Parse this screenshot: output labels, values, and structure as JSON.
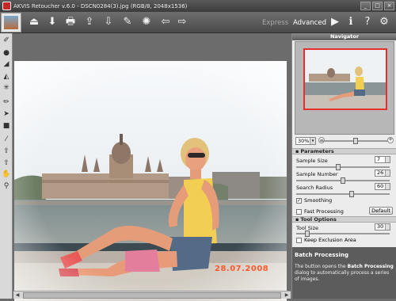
{
  "window": {
    "title": "AKVIS Retoucher v.6.0 - DSCN0284(3).jpg (RGB/8, 2048x1536)",
    "minimize": "_",
    "maximize": "□",
    "close": "×"
  },
  "toolbar": {
    "buttons": [
      "open-icon",
      "save-icon",
      "print-icon",
      "import-icon",
      "export-icon",
      "settings-icon",
      "effect-icon",
      "back-icon",
      "forward-icon"
    ],
    "express_label": "Express",
    "advanced_label": "Advanced",
    "right_buttons": [
      "run-icon",
      "info-icon",
      "help-icon",
      "preferences-icon"
    ]
  },
  "left_tools": [
    "brush-icon",
    "sphere-icon",
    "eraser-icon",
    "fill-icon",
    "magic-wand-icon",
    "pencil-icon",
    "arrow-icon",
    "stamp-icon",
    "pipette-icon",
    "transfer-icon",
    "upload-icon",
    "hand-icon",
    "zoom-icon"
  ],
  "photo": {
    "date_stamp": "28.07.2008"
  },
  "navigator": {
    "title": "Navigator",
    "zoom": "30%"
  },
  "parameters": {
    "title": "Parameters",
    "sample_size_label": "Sample Size",
    "sample_size": "7",
    "sample_size_level": 0.45,
    "sample_number_label": "Sample Number",
    "sample_number": "26",
    "sample_number_level": 0.5,
    "search_radius_label": "Search Radius",
    "search_radius": "60",
    "search_radius_level": 0.6,
    "smoothing_label": "Smoothing",
    "smoothing_checked": true,
    "fast_processing_label": "Fast Processing",
    "fast_processing_checked": false,
    "default_label": "Default"
  },
  "tool_options": {
    "title": "Tool Options",
    "tool_size_label": "Tool Size",
    "tool_size": "30",
    "tool_size_level": 0.1,
    "keep_exclusion_label": "Keep Exclusion Area",
    "keep_exclusion_checked": false
  },
  "batch": {
    "title": "Batch Processing",
    "desc_1": "The button opens the ",
    "desc_bold": "Batch Processing",
    "desc_2": " dialog to automatically process a series of images."
  },
  "colors": {
    "accent_red": "#e63030",
    "date_orange": "#ff5a2a"
  }
}
